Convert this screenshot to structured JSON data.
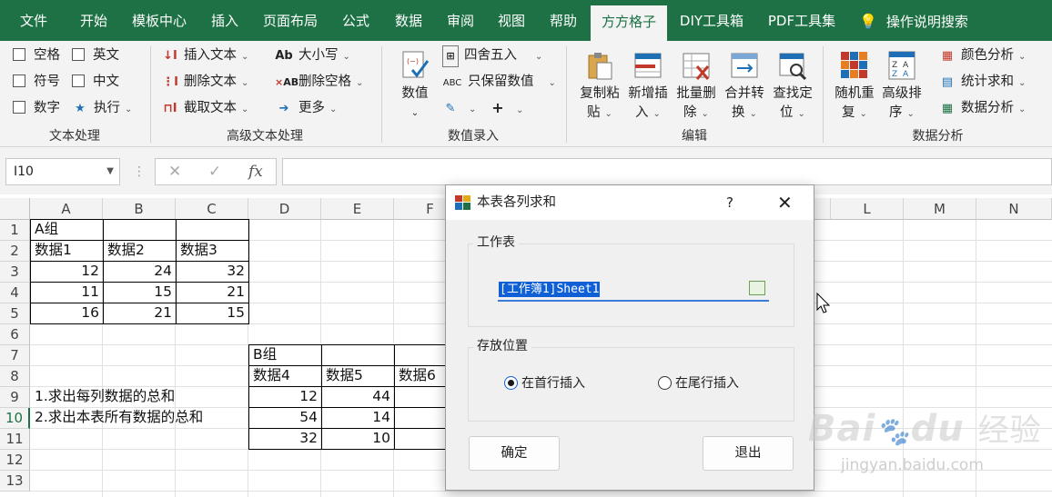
{
  "ribbon_tabs": [
    "文件",
    "开始",
    "模板中心",
    "插入",
    "页面布局",
    "公式",
    "数据",
    "审阅",
    "视图",
    "帮助",
    "方方格子",
    "DIY工具箱",
    "PDF工具集",
    "操作说明搜索"
  ],
  "active_tab": "方方格子",
  "text_group": {
    "checks": [
      "空格",
      "英文",
      "符号",
      "中文",
      "数字"
    ],
    "exec": "执行",
    "label": "文本处理"
  },
  "adv_text_group": {
    "insert": "插入文本",
    "delete": "删除文本",
    "cut": "截取文本",
    "case": "大小写",
    "case_icon": "Ab",
    "delspace": "删除空格",
    "delspace_icon": "AB",
    "more": "更多",
    "label": "高级文本处理"
  },
  "numeric_group": {
    "value": "数值",
    "round": "四舍五入",
    "keep": "只保留数值",
    "keep_icon": "ABC",
    "label": "数值录入"
  },
  "edit_group": {
    "buttons": [
      {
        "l1": "复制粘",
        "l2": "贴"
      },
      {
        "l1": "新增插",
        "l2": "入"
      },
      {
        "l1": "批量删",
        "l2": "除"
      },
      {
        "l1": "合并转",
        "l2": "换"
      },
      {
        "l1": "查找定",
        "l2": "位"
      }
    ],
    "label": "编辑"
  },
  "analysis_group": {
    "buttons": [
      {
        "l1": "随机重",
        "l2": "复"
      },
      {
        "l1": "高级排",
        "l2": "序"
      }
    ],
    "sort_icon_letters": [
      "Z",
      "A",
      "Z",
      "A"
    ],
    "color": "颜色分析",
    "stats": "统计求和",
    "data": "数据分析",
    "label": "数据分析"
  },
  "formula_bar": {
    "name_box": "I10",
    "fx": "fx"
  },
  "columns": [
    "A",
    "B",
    "C",
    "D",
    "E",
    "F",
    "L",
    "M",
    "N"
  ],
  "rows": [
    "1",
    "2",
    "3",
    "4",
    "5",
    "6",
    "7",
    "8",
    "9",
    "10",
    "11",
    "12",
    "13"
  ],
  "cells": {
    "a1": "A组",
    "a2": "数据1",
    "b2": "数据2",
    "c2": "数据3",
    "a3": "12",
    "b3": "24",
    "c3": "32",
    "a4": "11",
    "b4": "15",
    "c4": "21",
    "a5": "16",
    "b5": "21",
    "c5": "15",
    "d7": "B组",
    "d8": "数据4",
    "e8": "数据5",
    "f8": "数据6",
    "d9": "12",
    "e9": "44",
    "d10": "54",
    "e10": "14",
    "d11": "32",
    "e11": "10",
    "a9": "1.求出每列数据的总和",
    "a10": "2.求出本表所有数据的总和"
  },
  "dialog": {
    "title": "本表各列求和",
    "help": "?",
    "close": "✕",
    "worksheet_legend": "工作表",
    "worksheet_value": "[工作簿1]Sheet1",
    "position_legend": "存放位置",
    "radio_first": "在首行插入",
    "radio_last": "在尾行插入",
    "selected": "first",
    "ok": "确定",
    "exit": "退出"
  },
  "watermark": {
    "brand": "Bai",
    "paw": "du",
    "cn": "经验",
    "url": "jingyan.baidu.com"
  },
  "colors": {
    "excel_green": "#1e7145",
    "selection_blue": "#0f5fd6"
  }
}
